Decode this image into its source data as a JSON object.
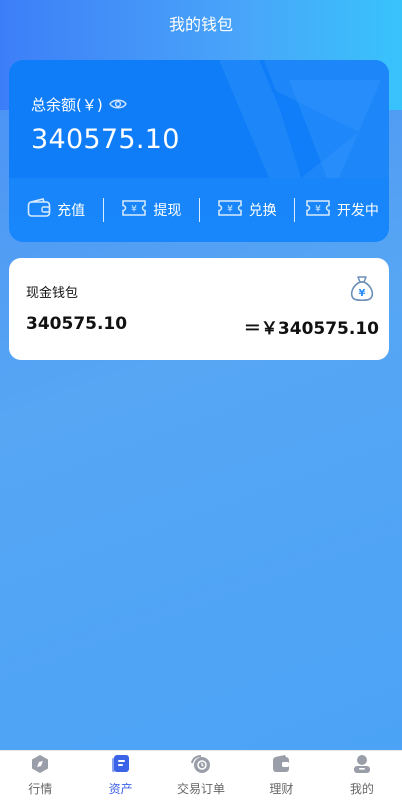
{
  "header": {
    "title": "我的钱包"
  },
  "balance": {
    "label": "总余额(￥)",
    "value": "340575.10",
    "visibility_icon": "eye-icon"
  },
  "actions": [
    {
      "label": "充值",
      "icon": "wallet-icon"
    },
    {
      "label": "提现",
      "icon": "ticket-icon"
    },
    {
      "label": "兑换",
      "icon": "ticket-icon"
    },
    {
      "label": "开发中",
      "icon": "ticket-icon"
    }
  ],
  "wallet": {
    "title": "现金钱包",
    "amount": "340575.10",
    "cny_amount": "＝￥340575.10",
    "icon": "money-bag-icon"
  },
  "tabbar": {
    "items": [
      {
        "label": "行情",
        "icon": "compass-icon",
        "active": false
      },
      {
        "label": "资产",
        "icon": "asset-icon",
        "active": true
      },
      {
        "label": "交易订单",
        "icon": "order-icon",
        "active": false
      },
      {
        "label": "理财",
        "icon": "finance-icon",
        "active": false
      },
      {
        "label": "我的",
        "icon": "user-icon",
        "active": false
      }
    ]
  },
  "colors": {
    "accent": "#3b63e8",
    "card_blue": "#0f7df8",
    "background": "#4a8ff5"
  }
}
